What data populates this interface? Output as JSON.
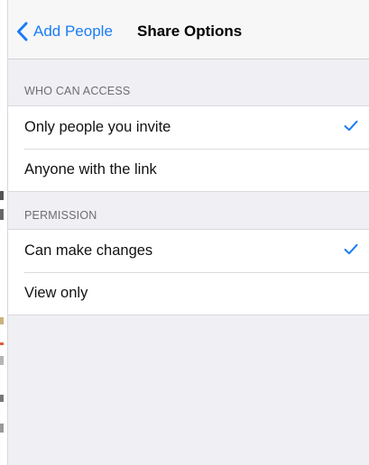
{
  "navbar": {
    "back_label": "Add People",
    "title": "Share Options"
  },
  "sections": [
    {
      "header": "WHO CAN ACCESS",
      "options": [
        {
          "label": "Only people you invite",
          "selected": true
        },
        {
          "label": "Anyone with the link",
          "selected": false
        }
      ]
    },
    {
      "header": "PERMISSION",
      "options": [
        {
          "label": "Can make changes",
          "selected": true
        },
        {
          "label": "View only",
          "selected": false
        }
      ]
    }
  ],
  "colors": {
    "accent": "#1a7cf6",
    "background": "#efeff4",
    "cell": "#ffffff",
    "header_text": "#6d6d72"
  },
  "icons": {
    "back": "chevron-left-icon",
    "selected": "checkmark-icon"
  }
}
